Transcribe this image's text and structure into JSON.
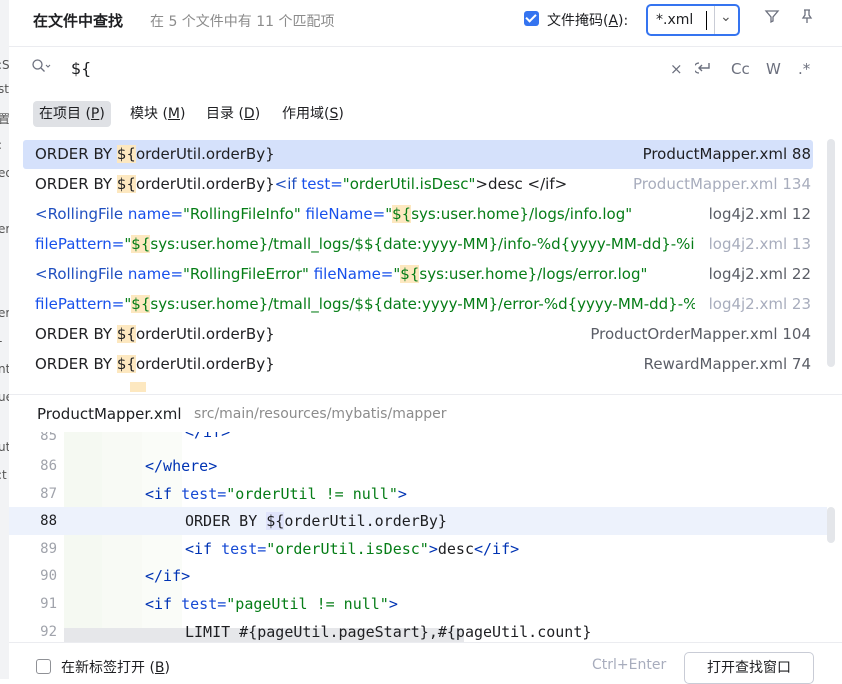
{
  "header": {
    "title": "在文件中查找",
    "summary": "在 5 个文件中有 11 个匹配项",
    "file_mask_label": "文件掩码(",
    "file_mask_key": "A",
    "file_mask_suffix": "):",
    "file_mask_checked": true,
    "file_mask_value": "*.xml"
  },
  "search": {
    "query": "${",
    "options": [
      "Cc",
      "W",
      ".*"
    ]
  },
  "scope_tabs": [
    {
      "label": "在项目 (",
      "key": "P",
      "suffix": ")",
      "selected": true
    },
    {
      "label": "模块 (",
      "key": "M",
      "suffix": ")"
    },
    {
      "label": "目录 (",
      "key": "D",
      "suffix": ")"
    },
    {
      "label": "作用域(",
      "key": "S",
      "suffix": ")"
    }
  ],
  "results": [
    {
      "p1": "ORDER BY ",
      "hl": "${",
      "p2": "orderUtil.orderBy}",
      "file": "ProductMapper.xml 88"
    },
    {
      "p1": "ORDER BY ",
      "hl": "${",
      "p2": "orderUtil.orderBy}",
      "tag_open": "<if ",
      "attr": "test=",
      "sval": "\"orderUtil.isDesc\"",
      "p3": ">desc </if>",
      "file": "ProductMapper.xml 134"
    },
    {
      "lt": "<",
      "tag": "RollingFile ",
      "attr": "name=",
      "sval": "\"RollingFileInfo\" ",
      "attr2": "fileName=",
      "sval2a": "\"",
      "hl": "${",
      "sval2b": "sys:user.home}/logs/info.log\"",
      "file": "log4j2.xml 12"
    },
    {
      "attr": "filePattern=",
      "sval": "\"",
      "hl": "${",
      "sval2b": "sys:user.home}/tmall_logs/$${date:yyyy-MM}/info-%d{yyyy-MM-dd}-%i.log.gz\"",
      "file": "log4j2.xml 13"
    },
    {
      "lt": "<",
      "tag": "RollingFile ",
      "attr": "name=",
      "sval": "\"RollingFileError\" ",
      "attr2": "fileName=",
      "sval2a": "\"",
      "hl": "${",
      "sval2b": "sys:user.home}/logs/error.log\"",
      "file": "log4j2.xml 22"
    },
    {
      "attr": "filePattern=",
      "sval": "\"",
      "hl": "${",
      "sval2b": "sys:user.home}/tmall_logs/$${date:yyyy-MM}/error-%d{yyyy-MM-dd}-%i.log.gz\"",
      "file": "log4j2.xml 23"
    },
    {
      "p1": "ORDER BY ",
      "hl": "${",
      "p2": "orderUtil.orderBy}",
      "file": "ProductOrderMapper.xml 104"
    },
    {
      "p1": "ORDER BY ",
      "hl": "${",
      "p2": "orderUtil.orderBy}",
      "file": "RewardMapper.xml 74"
    }
  ],
  "preview": {
    "file": "ProductMapper.xml",
    "path": "src/main/resources/mybatis/mapper",
    "lines": [
      {
        "n": "85",
        "t": "</if>"
      },
      {
        "n": "86",
        "t": "</where>"
      },
      {
        "n": "87",
        "t": "<if test=\"orderUtil != null\">"
      },
      {
        "n": "88",
        "t": "ORDER BY ${orderUtil.orderBy}"
      },
      {
        "n": "89",
        "t": "<if test=\"orderUtil.isDesc\">desc</if>"
      },
      {
        "n": "90",
        "t": "</if>"
      },
      {
        "n": "91",
        "t": "<if test=\"pageUtil != null\">"
      },
      {
        "n": "92",
        "t": "LIMIT #{pageUtil.pageStart},#{pageUtil.count}"
      }
    ]
  },
  "footer": {
    "new_tab_label": "在新标签打开 (",
    "new_tab_key": "B",
    "new_tab_suffix": ")",
    "shortcut": "Ctrl+Enter",
    "open_button": "打开查找窗口"
  },
  "colors": {
    "accent": "#3574f0",
    "selection": "#d5e1fb",
    "match_highlight": "#fde8c0"
  }
}
